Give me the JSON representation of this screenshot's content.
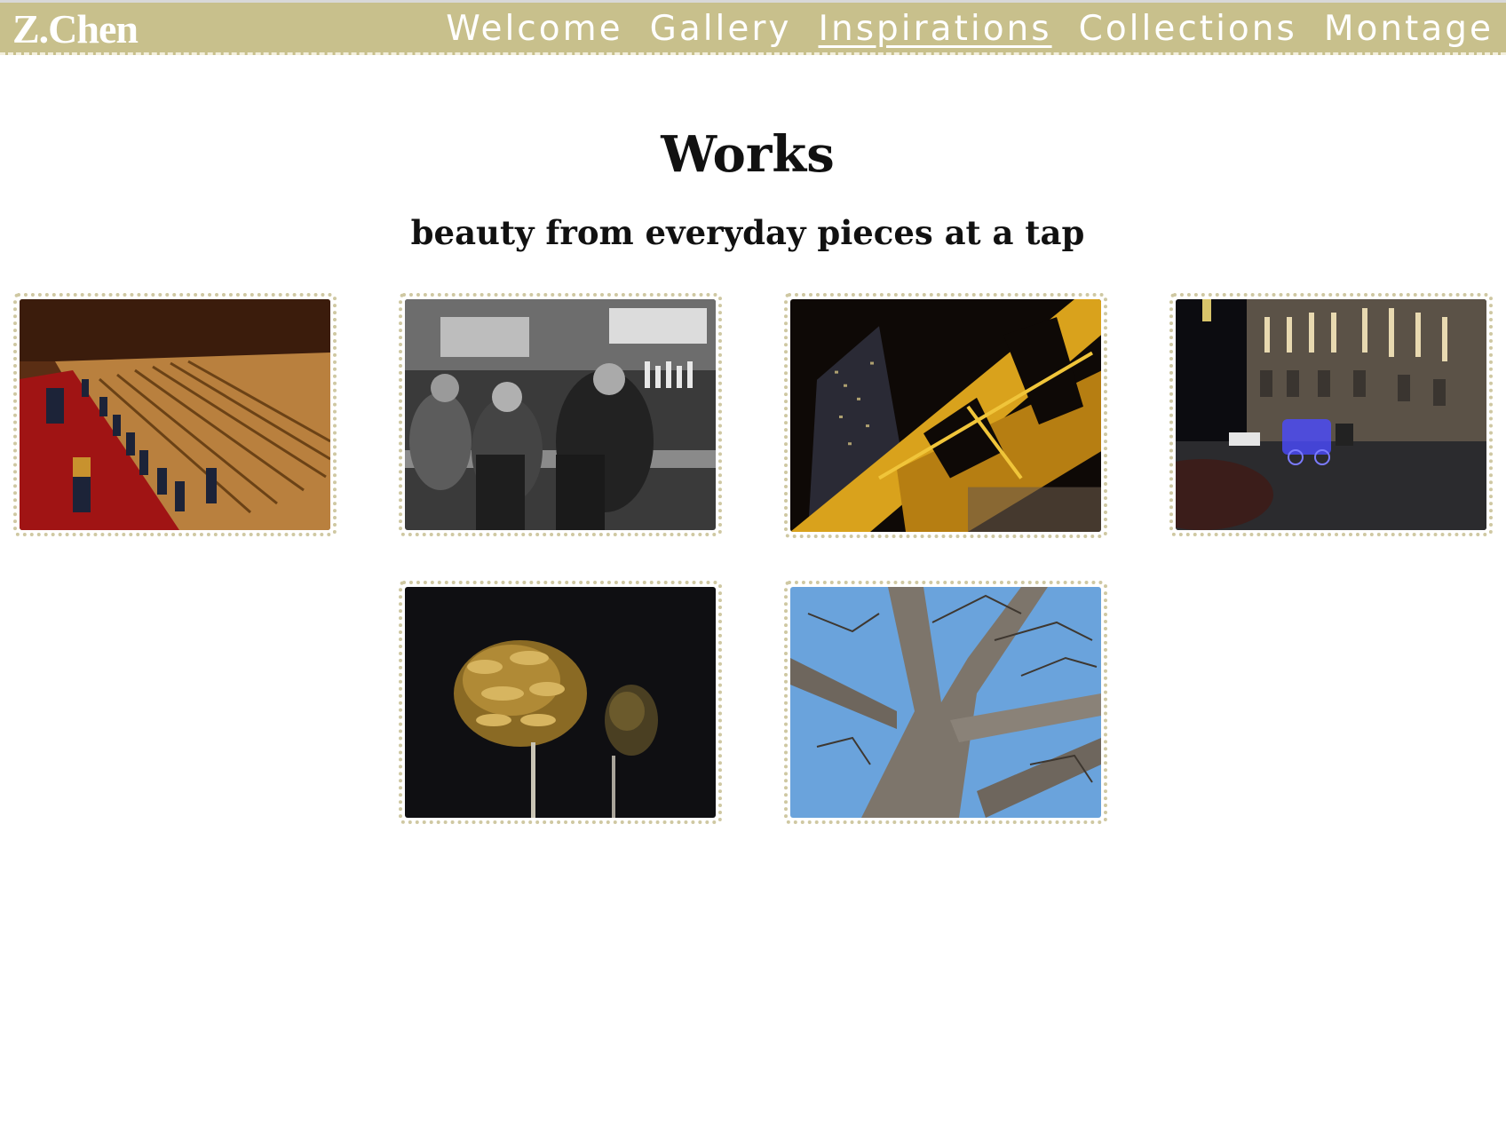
{
  "header": {
    "brand": "Z.Chen",
    "nav": [
      {
        "label": "Welcome",
        "active": false
      },
      {
        "label": "Gallery",
        "active": false
      },
      {
        "label": "Inspirations",
        "active": true
      },
      {
        "label": "Collections",
        "active": false
      },
      {
        "label": "Montage",
        "active": false
      }
    ]
  },
  "main": {
    "title": "Works",
    "subtitle": "beauty from everyday pieces at a tap"
  },
  "colors": {
    "navbar": "#c8c08c",
    "card_border": "#cfc8a2",
    "text": "#111111"
  }
}
